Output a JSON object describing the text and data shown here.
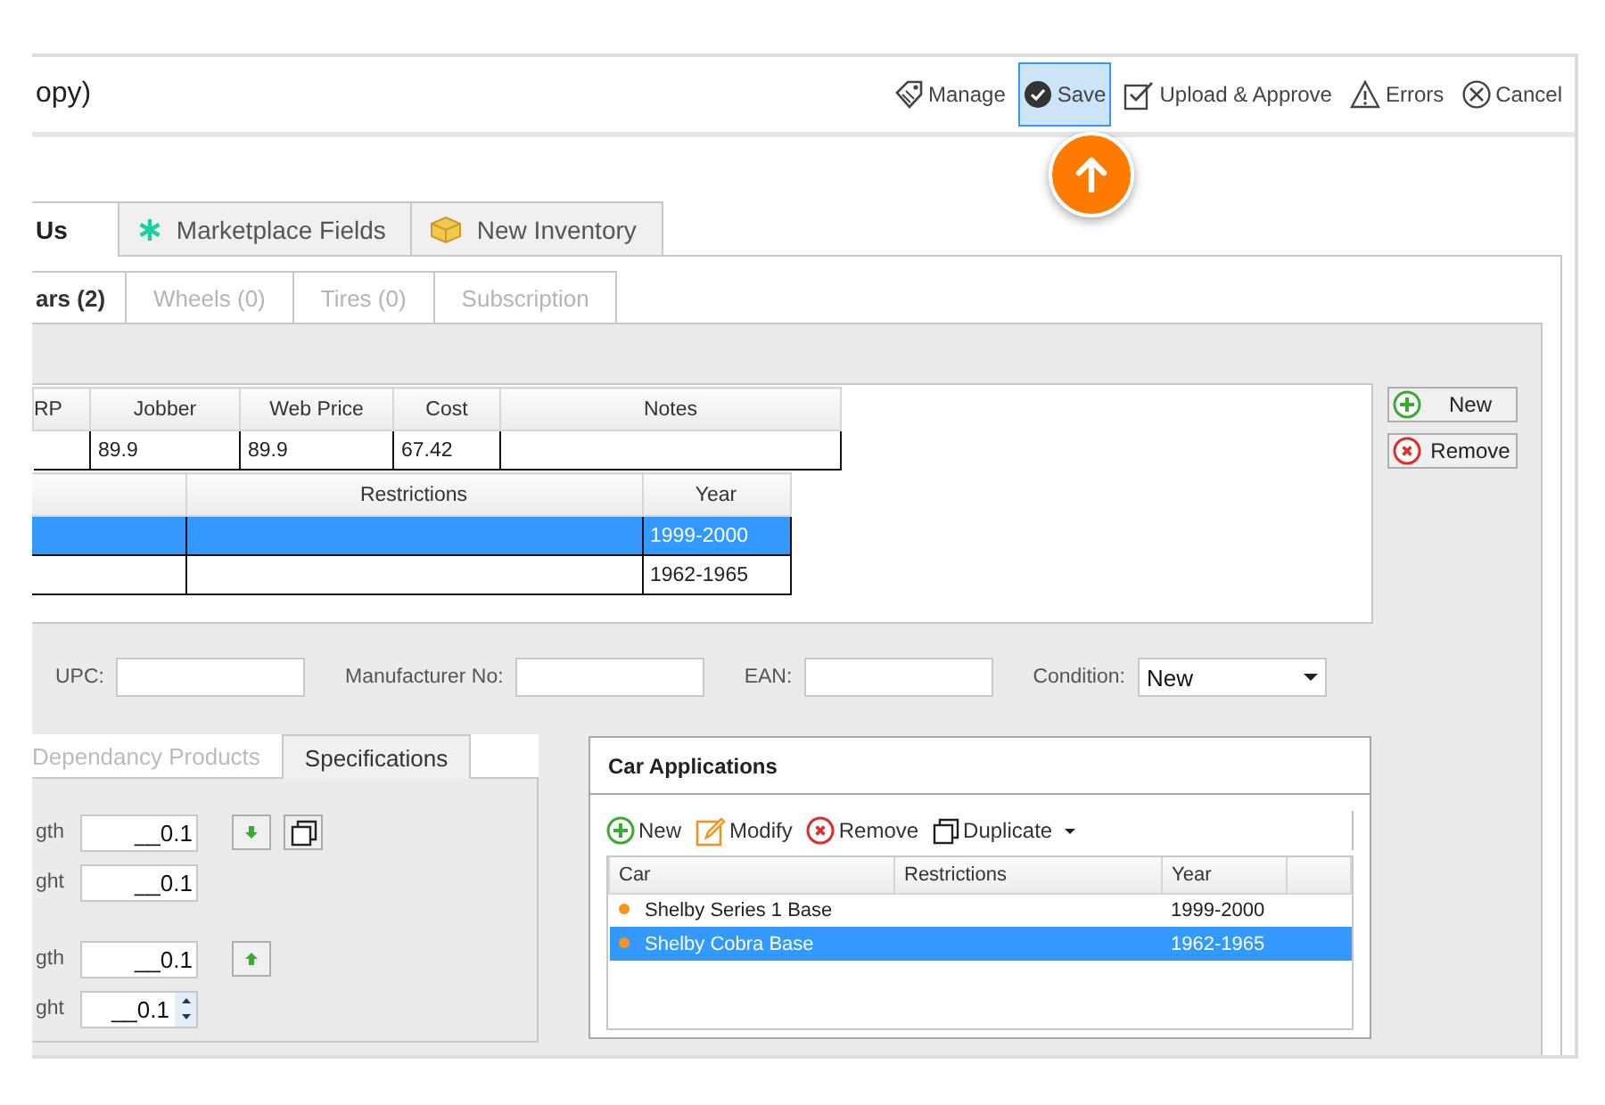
{
  "window": {
    "title": "opy)"
  },
  "toolbar": [
    {
      "kind": "manage",
      "label": "Manage",
      "selected": false
    },
    {
      "kind": "save",
      "label": "Save",
      "selected": true
    },
    {
      "kind": "approve",
      "label": "Upload & Approve",
      "selected": false
    },
    {
      "kind": "errors",
      "label": "Errors",
      "selected": false
    },
    {
      "kind": "cancel",
      "label": "Cancel",
      "selected": false
    }
  ],
  "tabs": [
    {
      "kind": "plain",
      "label": "Us",
      "selected": true
    },
    {
      "kind": "asterisk",
      "label": "Marketplace Fields",
      "selected": false
    },
    {
      "kind": "box",
      "label": "New Inventory",
      "selected": false
    }
  ],
  "subtabs": [
    {
      "label": "ars (2)",
      "selected": true,
      "disabled": false
    },
    {
      "label": "Wheels (0)",
      "selected": false,
      "disabled": true
    },
    {
      "label": "Tires (0)",
      "selected": false,
      "disabled": true
    },
    {
      "label": "Subscription",
      "selected": false,
      "disabled": true
    }
  ],
  "pricing_table": {
    "columns": [
      "RP",
      "Jobber",
      "Web Price",
      "Cost",
      "Notes"
    ],
    "rows": [
      {
        "cells": [
          null,
          "89.9",
          "89.9",
          "67.42",
          null
        ]
      }
    ]
  },
  "applications_table": {
    "columns": [
      "Restrictions",
      "Year"
    ],
    "rows": [
      {
        "year": "1999-2000",
        "selected": true
      },
      {
        "year": "1962-1965",
        "selected": false
      }
    ]
  },
  "side_buttons": [
    {
      "kind": "new",
      "label": "New"
    },
    {
      "kind": "remove",
      "label": "Remove"
    }
  ],
  "fields": [
    {
      "kind": "text",
      "label": "UPC:"
    },
    {
      "kind": "text",
      "label": "Manufacturer No:"
    },
    {
      "kind": "text",
      "label": "EAN:"
    },
    {
      "kind": "select",
      "label": "Condition:",
      "value": "New"
    }
  ],
  "spec_tabs": [
    {
      "label": "Dependancy Products",
      "selected": false
    },
    {
      "label": "Specifications",
      "selected": true
    }
  ],
  "spec_groups": [
    [
      {
        "kind": "down",
        "label": "gth",
        "value": "__0.1"
      },
      {
        "kind": "plain",
        "label": "ght",
        "value": "__0.1"
      }
    ],
    [
      {
        "kind": "up",
        "label": "gth",
        "value": "__0.1"
      },
      {
        "kind": "spinner",
        "label": "ght",
        "value": "__0.1"
      }
    ]
  ],
  "car_applications": {
    "title": "Car Applications",
    "toolbar": [
      {
        "kind": "new",
        "label": "New"
      },
      {
        "kind": "modify",
        "label": "Modify"
      },
      {
        "kind": "remove",
        "label": "Remove"
      },
      {
        "kind": "duplicate",
        "label": "Duplicate"
      }
    ],
    "columns": [
      "Car",
      "Restrictions",
      "Year"
    ],
    "rows": [
      {
        "car": "Shelby Series 1 Base",
        "year": "1999-2000",
        "selected": false
      },
      {
        "car": "Shelby Cobra Base",
        "year": "1962-1965",
        "selected": true
      }
    ]
  }
}
